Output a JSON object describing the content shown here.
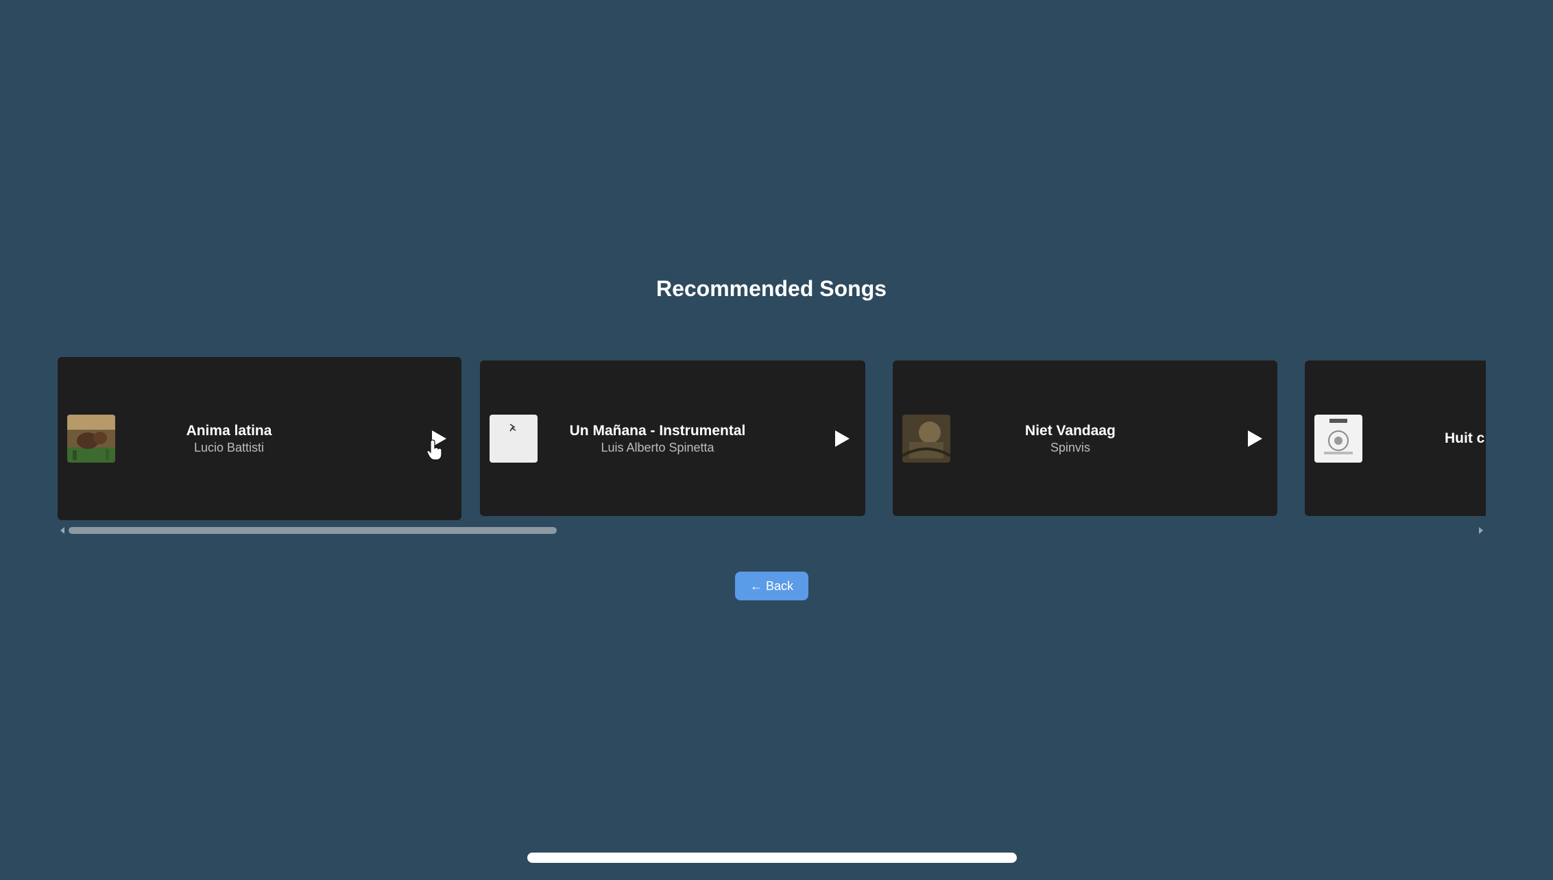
{
  "page": {
    "title": "Recommended Songs"
  },
  "songs": [
    {
      "title": "Anima latina",
      "artist": "Lucio Battisti",
      "play_icon": "play-icon"
    },
    {
      "title": "Un Mañana - Instrumental",
      "artist": "Luis Alberto Spinetta",
      "play_icon": "play-icon"
    },
    {
      "title": "Niet Vandaag",
      "artist": "Spinvis",
      "play_icon": "play-icon"
    },
    {
      "title": "Huit c",
      "artist": "",
      "play_icon": "play-icon"
    }
  ],
  "back_button": {
    "label": "← Back"
  },
  "colors": {
    "background": "#2e4a5e",
    "card": "#1e1e1e",
    "accent": "#5b9be8",
    "scroll_thumb": "#8c99a3"
  }
}
